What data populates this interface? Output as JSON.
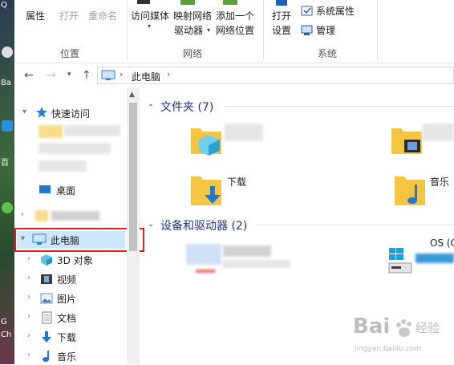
{
  "ribbon": {
    "properties": "属性",
    "open": "打开",
    "rename": "重命名",
    "group_location": "位置",
    "access_media": "访问媒体",
    "map_drive_line1": "映射网络",
    "map_drive_line2": "驱动器",
    "add_location_line1": "添加一个",
    "add_location_line2": "网络位置",
    "group_network": "网络",
    "open_settings_line1": "打开",
    "open_settings_line2": "设置",
    "system_properties": "系统属性",
    "manage": "管理",
    "group_system": "系统"
  },
  "address": {
    "location": "此电脑",
    "separator": "›"
  },
  "nav": {
    "quick_access": "快速访问",
    "desktop": "桌面",
    "this_pc": "此电脑",
    "objects_3d": "3D 对象",
    "videos": "视频",
    "pictures": "图片",
    "documents": "文档",
    "downloads": "下载",
    "music": "音乐"
  },
  "content": {
    "folders_header": "文件夹 (7)",
    "downloads": "下载",
    "music": "音乐",
    "devices_header": "设备和驱动器 (2)",
    "drive_os": "OS (C"
  },
  "desktop_strip": {
    "label_q": "Q",
    "label_ba": "Ba",
    "label_bai": "百",
    "label_g": "G",
    "label_ch": "Ch"
  },
  "watermark": {
    "brand": "Bai",
    "brand2": "经验",
    "url": "jingyan.baidu.com"
  },
  "colors": {
    "accent": "#1e3287",
    "selection": "#cce8ff",
    "highlight_box": "#e02020",
    "folder": "#f4c542"
  }
}
